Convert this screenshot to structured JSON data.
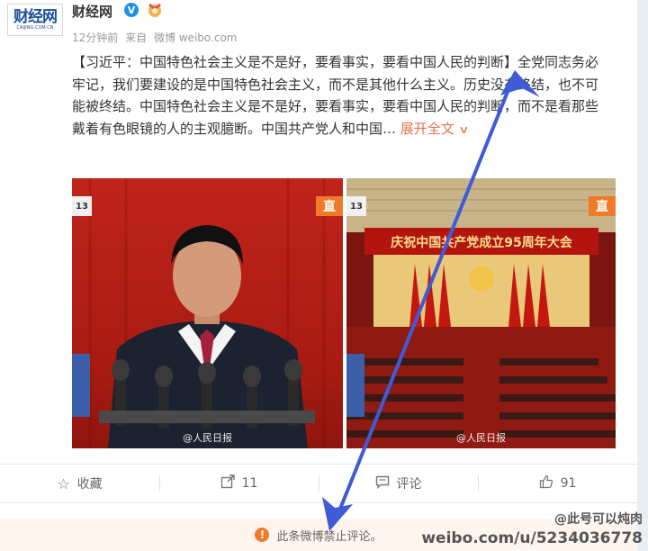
{
  "account": {
    "avatar_logo": "财经网",
    "avatar_sub": "CAIJING.COM.CN",
    "name": "财经网",
    "verified_mark": "V"
  },
  "meta": {
    "time": "12分钟前",
    "source_prefix": "来自",
    "source": "微博 weibo.com"
  },
  "post": {
    "text": "【习近平：中国特色社会主义是不是好，要看事实，要看中国人民的判断】全党同志务必牢记，我们要建设的是中国特色社会主义，而不是其他什么主义。历史没有终结，也不可能被终结。中国特色社会主义是不是好，要看事实，要看中国人民的判断，而不是看那些戴着有色眼镜的人的主观臆断。中国共产党人和中国…",
    "expand_label": "展开全文",
    "expand_icon": "chevron-down-icon"
  },
  "images": [
    {
      "watermark": "@人民日报",
      "live_badge": "直",
      "channel": "13"
    },
    {
      "watermark": "@人民日报",
      "live_badge": "直",
      "channel": "13",
      "banner_text": "庆祝中国共产党成立95周年大会"
    }
  ],
  "actions": {
    "favorite": {
      "label": "收藏",
      "icon": "star-icon"
    },
    "repost": {
      "label": "11",
      "icon": "share-icon"
    },
    "comment": {
      "label": "评论",
      "icon": "comment-icon"
    },
    "like": {
      "label": "91",
      "icon": "thumbs-up-icon"
    }
  },
  "banner": {
    "text": "此条微博禁止评论。",
    "icon": "warning-icon"
  },
  "corner_watermark": {
    "line1": "@此号可以炖肉",
    "line2": "weibo.com/u/5234036778"
  },
  "colors": {
    "accent": "#eb7350",
    "verified": "#1f90e8",
    "arrow": "#3f5bd8",
    "warning": "#f07a27"
  }
}
